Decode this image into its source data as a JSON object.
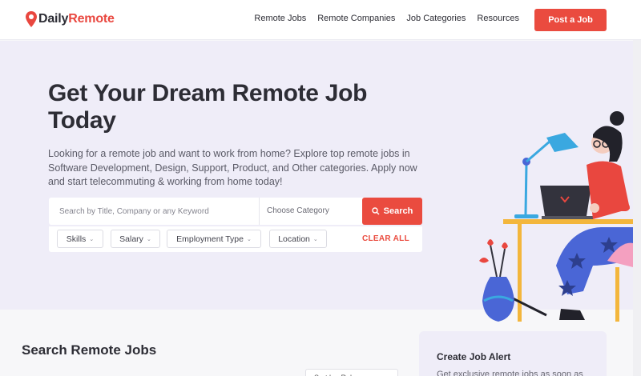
{
  "brand": {
    "part1": "Daily",
    "part2": "Remote"
  },
  "nav": [
    "Remote Jobs",
    "Remote Companies",
    "Job Categories",
    "Resources"
  ],
  "post_job_label": "Post a Job",
  "hero": {
    "title": "Get Your Dream Remote Job Today",
    "subtitle": "Looking for a remote job and want to work from home? Explore top remote jobs in Software Development, Design, Support, Product, and Other categories. Apply now and start telecommuting & working from home today!"
  },
  "search": {
    "placeholder": "Search by Title, Company or any Keyword",
    "category_label": "Choose Category",
    "button_label": "Search"
  },
  "filters": [
    "Skills",
    "Salary",
    "Employment Type",
    "Location"
  ],
  "clear_all_label": "CLEAR ALL",
  "lower": {
    "title": "Search Remote Jobs",
    "sort_label": "Sort by: Relevance"
  },
  "job_alert": {
    "title": "Create Job Alert",
    "text": "Get exclusive remote jobs as soon as"
  },
  "colors": {
    "accent": "#ea4b3f",
    "hero_bg": "#efedf8",
    "text": "#2d2d35"
  }
}
